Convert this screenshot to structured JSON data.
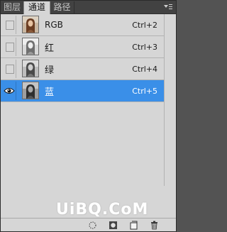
{
  "tabs": [
    {
      "label": "图层",
      "active": false
    },
    {
      "label": "通道",
      "active": true
    },
    {
      "label": "路径",
      "active": false
    }
  ],
  "channels": [
    {
      "name": "RGB",
      "shortcut": "Ctrl+2",
      "visible": false,
      "selected": false,
      "thumb": "color"
    },
    {
      "name": "红",
      "shortcut": "Ctrl+3",
      "visible": false,
      "selected": false,
      "thumb": "gray-light"
    },
    {
      "name": "绿",
      "shortcut": "Ctrl+4",
      "visible": false,
      "selected": false,
      "thumb": "gray-mid"
    },
    {
      "name": "蓝",
      "shortcut": "Ctrl+5",
      "visible": true,
      "selected": true,
      "thumb": "gray-dark"
    }
  ],
  "toolbar": {
    "icons": [
      "load-channel-selection-icon",
      "save-selection-as-channel-icon",
      "new-channel-icon",
      "delete-channel-icon"
    ]
  },
  "watermark": "UiBQ.CoM",
  "colors": {
    "panel_bg": "#d6d6d6",
    "tabbar_bg": "#424242",
    "selected_row": "#3a8fe8",
    "row_divider": "#b2b2b2"
  }
}
